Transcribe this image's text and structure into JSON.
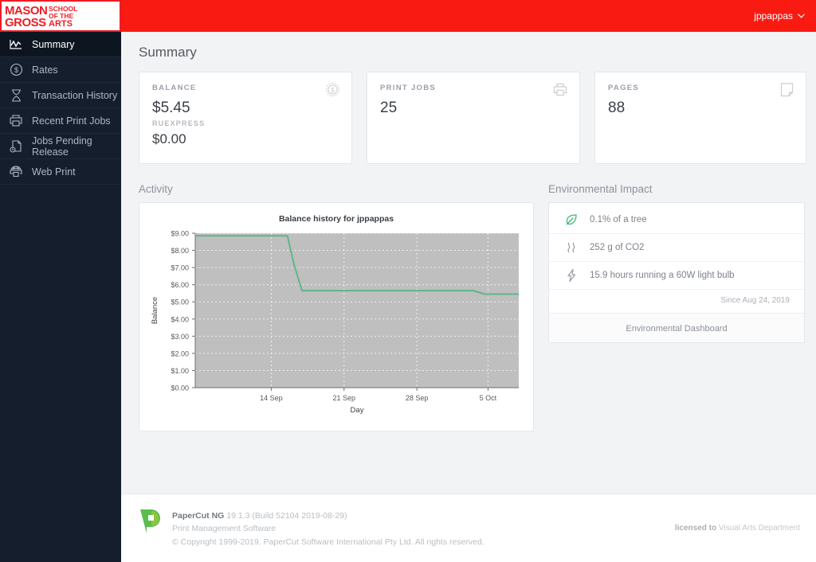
{
  "brand": {
    "logo_line1": "MASON",
    "logo_line2": "GROSS",
    "logo_line3a": "SCHOOL",
    "logo_line3b": "OF THE",
    "logo_line3c": "ARTS",
    "logo_color": "#ee1c25",
    "topbar_color": "#f91b12"
  },
  "topbar": {
    "username": "jppappas",
    "chevron_icon": "chevron-down-icon"
  },
  "sidebar": {
    "background": "#141e2d",
    "items": [
      {
        "label": "Summary",
        "icon": "line-chart-icon",
        "active": true
      },
      {
        "label": "Rates",
        "icon": "dollar-circle-icon",
        "active": false
      },
      {
        "label": "Transaction History",
        "icon": "hourglass-icon",
        "active": false
      },
      {
        "label": "Recent Print Jobs",
        "icon": "printer-icon",
        "active": false
      },
      {
        "label": "Jobs Pending Release",
        "icon": "document-clock-icon",
        "active": false
      },
      {
        "label": "Web Print",
        "icon": "globe-printer-icon",
        "active": false
      }
    ]
  },
  "page": {
    "title": "Summary"
  },
  "cards": {
    "balance": {
      "label": "BALANCE",
      "value": "$5.45",
      "sublabel": "RUEXPRESS",
      "subvalue": "$0.00",
      "icon": "dollar-coin-icon"
    },
    "print_jobs": {
      "label": "PRINT JOBS",
      "value": "25",
      "icon": "printer-icon"
    },
    "pages": {
      "label": "PAGES",
      "value": "88",
      "icon": "page-icon"
    }
  },
  "activity": {
    "heading": "Activity"
  },
  "environmental": {
    "heading": "Environmental Impact",
    "rows": [
      {
        "icon": "leaf-icon",
        "text": "0.1% of a tree",
        "color": "#3cb878"
      },
      {
        "icon": "co2-smoke-icon",
        "text": "252 g of CO2",
        "color": "#9aa0a8"
      },
      {
        "icon": "lightning-bolt-icon",
        "text": "15.9 hours running a 60W light bulb",
        "color": "#9aa0a8"
      }
    ],
    "since": "Since Aug 24, 2019",
    "dashboard_link": "Environmental Dashboard"
  },
  "footer": {
    "product": "PaperCut NG",
    "version": "19.1.3 (Build 52104 2019-08-29)",
    "tagline": "Print Management Software",
    "copyright": "© Copyright 1999-2019. PaperCut Software International Pty Ltd. All rights reserved.",
    "license_prefix": "licensed to",
    "license_org": "Visual Arts Department",
    "logo_icon": "papercut-logo-icon"
  },
  "chart_data": {
    "type": "line",
    "title": "Balance history for jppappas",
    "xlabel": "Day",
    "ylabel": "Balance",
    "ylim": [
      0,
      9
    ],
    "yticks": [
      0,
      1,
      2,
      3,
      4,
      5,
      6,
      7,
      8,
      9
    ],
    "ytick_labels": [
      "$0.00",
      "$1.00",
      "$2.00",
      "$3.00",
      "$4.00",
      "$5.00",
      "$6.00",
      "$7.00",
      "$8.00",
      "$9.00"
    ],
    "xtick_labels": [
      "14 Sep",
      "21 Sep",
      "28 Sep",
      "5 Oct"
    ],
    "xtick_positions": [
      0.235,
      0.46,
      0.685,
      0.905
    ],
    "grid": true,
    "plot_bg": "#bfbfbf",
    "line_color": "#55b583",
    "series": [
      {
        "name": "Balance",
        "x": [
          0.0,
          0.285,
          0.305,
          0.33,
          0.86,
          0.895,
          1.0
        ],
        "values": [
          8.85,
          8.85,
          7.2,
          5.65,
          5.65,
          5.45,
          5.45
        ]
      }
    ]
  }
}
